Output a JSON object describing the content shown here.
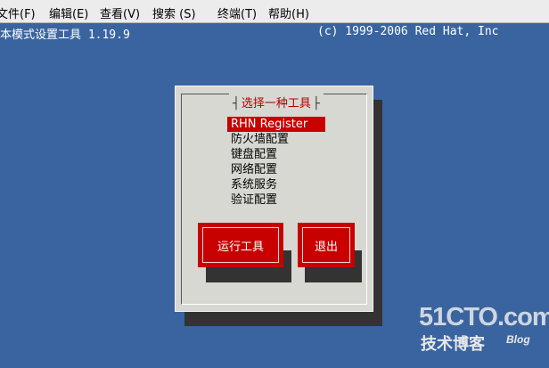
{
  "menubar": {
    "items": [
      {
        "label": "文件(F)"
      },
      {
        "label": "编辑(E)"
      },
      {
        "label": "查看(V)"
      },
      {
        "label": "搜索 (S)"
      },
      {
        "label": "终端(T)"
      },
      {
        "label": "帮助(H)"
      }
    ]
  },
  "terminal": {
    "header_left": "本模式设置工具 1.19.9",
    "header_right": "(c) 1999-2006 Red Hat, Inc"
  },
  "dialog": {
    "title": "选择一种工具",
    "options": [
      "RHN Register",
      "防火墙配置",
      "键盘配置",
      "网络配置",
      "系统服务",
      "验证配置"
    ],
    "selected_index": 0,
    "run_button": "运行工具",
    "quit_button": "退出"
  },
  "watermark": {
    "site": "51CTO.com",
    "subtitle": "技术博客",
    "blog": "Blog"
  },
  "colors": {
    "desktop": "#3a64a0",
    "dialog": "#d8d8d3",
    "accent_red": "#c80000",
    "shadow": "#333333"
  }
}
